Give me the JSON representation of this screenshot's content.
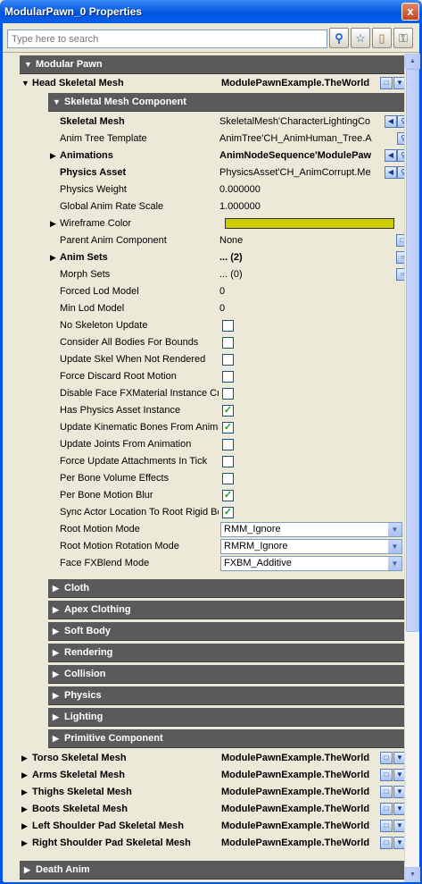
{
  "window": {
    "title": "ModularPawn_0 Properties",
    "close": "x"
  },
  "search": {
    "placeholder": "Type here to search"
  },
  "toolbar": {
    "search_icon": "search-icon",
    "star_icon": "star-icon",
    "copy_icon": "copy-icon",
    "lock_icon": "lock-icon"
  },
  "categories": {
    "modular_pawn": "Modular Pawn",
    "death_anim": "Death Anim"
  },
  "head": {
    "label": "Head Skeletal Mesh",
    "value": "ModulePawnExample.TheWorld"
  },
  "smc": {
    "label": "Skeletal Mesh Component"
  },
  "props": [
    {
      "label": "Skeletal Mesh",
      "value": "SkeletalMesh'CharacterLightingCo"
    },
    {
      "label": "Anim Tree Template",
      "value": "AnimTree'CH_AnimHuman_Tree.A"
    },
    {
      "label": "Animations",
      "value": "AnimNodeSequence'ModulePaw"
    },
    {
      "label": "Physics Asset",
      "value": "PhysicsAsset'CH_AnimCorrupt.Me"
    },
    {
      "label": "Physics Weight",
      "value": "0.000000"
    },
    {
      "label": "Global Anim Rate Scale",
      "value": "1.000000"
    },
    {
      "label": "Wireframe Color",
      "value": ""
    },
    {
      "label": "Parent Anim Component",
      "value": "None"
    },
    {
      "label": "Anim Sets",
      "value": "... (2)"
    },
    {
      "label": "Morph Sets",
      "value": "... (0)"
    },
    {
      "label": "Forced Lod Model",
      "value": "0"
    },
    {
      "label": "Min Lod Model",
      "value": "0"
    }
  ],
  "checks": [
    {
      "label": "No Skeleton Update",
      "checked": false
    },
    {
      "label": "Consider All Bodies For Bounds",
      "checked": false
    },
    {
      "label": "Update Skel When Not Rendered",
      "checked": false
    },
    {
      "label": "Force Discard Root Motion",
      "checked": false
    },
    {
      "label": "Disable Face FXMaterial Instance Cre",
      "checked": false
    },
    {
      "label": "Has Physics Asset Instance",
      "checked": true
    },
    {
      "label": "Update Kinematic Bones From Animat",
      "checked": true
    },
    {
      "label": "Update Joints From Animation",
      "checked": false
    },
    {
      "label": "Force Update Attachments In Tick",
      "checked": false
    },
    {
      "label": "Per Bone Volume Effects",
      "checked": false
    },
    {
      "label": "Per Bone Motion Blur",
      "checked": true
    },
    {
      "label": "Sync Actor Location To Root Rigid Bo",
      "checked": true
    }
  ],
  "combos": [
    {
      "label": "Root Motion Mode",
      "value": "RMM_Ignore"
    },
    {
      "label": "Root Motion Rotation Mode",
      "value": "RMRM_Ignore"
    },
    {
      "label": "Face FXBlend Mode",
      "value": "FXBM_Additive"
    }
  ],
  "subcats": [
    "Cloth",
    "Apex Clothing",
    "Soft Body",
    "Rendering",
    "Collision",
    "Physics",
    "Lighting",
    "Primitive Component"
  ],
  "meshes": [
    {
      "label": "Torso Skeletal Mesh",
      "value": "ModulePawnExample.TheWorld"
    },
    {
      "label": "Arms Skeletal Mesh",
      "value": "ModulePawnExample.TheWorld"
    },
    {
      "label": "Thighs Skeletal Mesh",
      "value": "ModulePawnExample.TheWorld"
    },
    {
      "label": "Boots Skeletal Mesh",
      "value": "ModulePawnExample.TheWorld"
    },
    {
      "label": "Left Shoulder Pad Skeletal Mesh",
      "value": "ModulePawnExample.TheWorld"
    },
    {
      "label": "Right Shoulder Pad Skeletal Mesh",
      "value": "ModulePawnExample.TheWorld"
    }
  ],
  "colors": {
    "wireframe": "#cccc00",
    "category_bg": "#5a5a5a",
    "title_blue": "#0054e3"
  }
}
